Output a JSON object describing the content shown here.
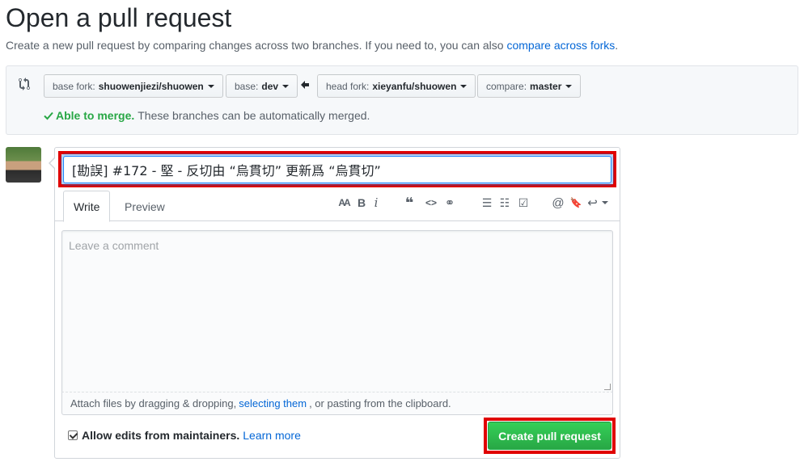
{
  "header": {
    "title": "Open a pull request",
    "subtitle": "Create a new pull request by comparing changes across two branches. If you need to, you can also",
    "subtitle_link": "compare across forks",
    "subtitle_end": "."
  },
  "range": {
    "base_fork_label": "base fork:",
    "base_fork_value": "shuowenjiezi/shuowen",
    "base_label": "base:",
    "base_value": "dev",
    "head_fork_label": "head fork:",
    "head_fork_value": "xieyanfu/shuowen",
    "compare_label": "compare:",
    "compare_value": "master",
    "merge_ok": "Able to merge.",
    "merge_text": "These branches can be automatically merged.",
    "status_color": "#28a745"
  },
  "form": {
    "title_value": "[勘誤] #172 - 堅 - 反切由 “烏貫切” 更新爲 “烏貫切”",
    "tabs": [
      "Write",
      "Preview"
    ],
    "comment_placeholder": "Leave a comment",
    "attach_prefix": "Attach files by dragging & dropping,",
    "attach_link": "selecting them",
    "attach_suffix": ", or pasting from the clipboard.",
    "allow_edits_label": "Allow edits from maintainers.",
    "learn_more": "Learn more",
    "submit_label": "Create pull request",
    "highlight_color": "#e00000"
  },
  "toolbar": {
    "header_text": "AA",
    "bold": "B",
    "italic": "i",
    "quote": "❝",
    "code": "<>",
    "link": "⚭",
    "ul": "☰",
    "ol": "☷",
    "tasks": "☑",
    "mention": "@",
    "ref": "🔖",
    "reply": "↩"
  }
}
